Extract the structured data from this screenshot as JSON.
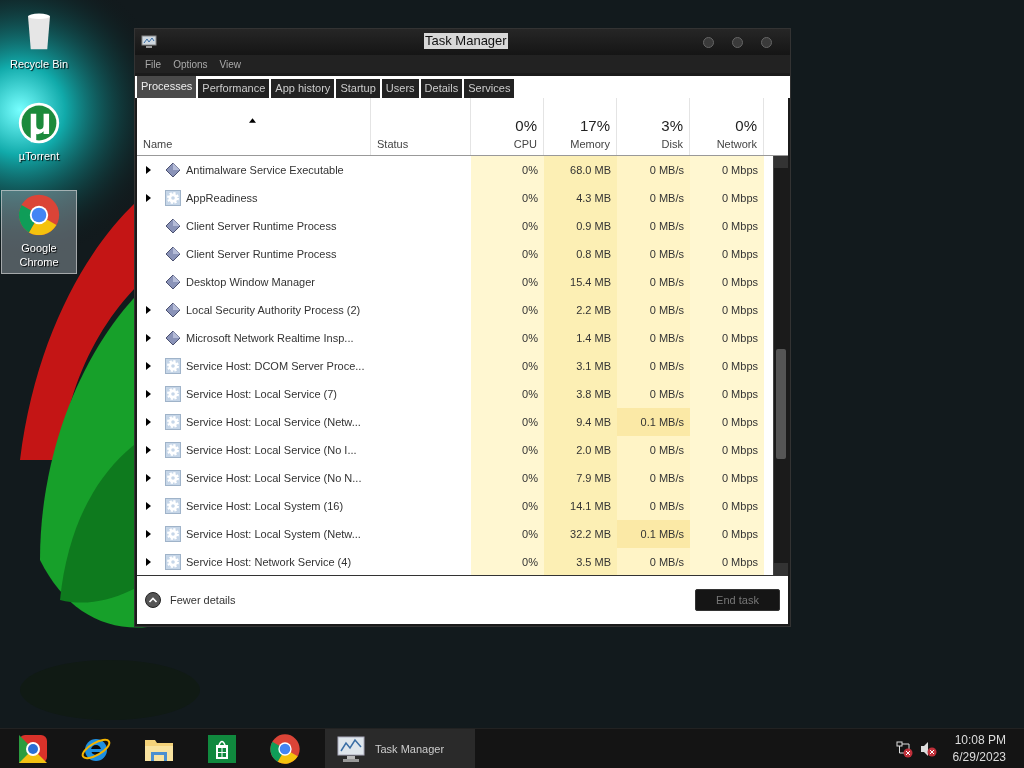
{
  "desktop": {
    "icons": [
      {
        "label": "Recycle Bin",
        "kind": "recycle",
        "selected": false
      },
      {
        "label": "µTorrent",
        "kind": "utorrent",
        "selected": false
      },
      {
        "label": "Google Chrome",
        "kind": "chrome",
        "selected": true
      }
    ]
  },
  "window": {
    "title": "Task Manager",
    "menu": [
      "File",
      "Options",
      "View"
    ],
    "tabs": [
      {
        "label": "Processes",
        "selected": true
      },
      {
        "label": "Performance",
        "selected": false
      },
      {
        "label": "App history",
        "selected": false
      },
      {
        "label": "Startup",
        "selected": false
      },
      {
        "label": "Users",
        "selected": false
      },
      {
        "label": "Details",
        "selected": false
      },
      {
        "label": "Services",
        "selected": false
      }
    ],
    "columns": [
      {
        "label": "Name",
        "sorted": true
      },
      {
        "label": "Status",
        "sorted": false
      },
      {
        "percent": "0%",
        "label": "CPU",
        "sorted": false
      },
      {
        "percent": "17%",
        "label": "Memory",
        "sorted": false
      },
      {
        "percent": "3%",
        "label": "Disk",
        "sorted": false
      },
      {
        "percent": "0%",
        "label": "Network",
        "sorted": false
      }
    ],
    "rows": [
      {
        "name": "Antimalware Service Executable",
        "kind": "diamond",
        "expandable": true,
        "cpu": "0%",
        "memory": "68.0 MB",
        "disk": "0 MB/s",
        "disk_active": false,
        "network": "0 Mbps"
      },
      {
        "name": "AppReadiness",
        "kind": "gear",
        "expandable": true,
        "cpu": "0%",
        "memory": "4.3 MB",
        "disk": "0 MB/s",
        "disk_active": false,
        "network": "0 Mbps"
      },
      {
        "name": "Client Server Runtime Process",
        "kind": "diamond",
        "expandable": false,
        "cpu": "0%",
        "memory": "0.9 MB",
        "disk": "0 MB/s",
        "disk_active": false,
        "network": "0 Mbps"
      },
      {
        "name": "Client Server Runtime Process",
        "kind": "diamond",
        "expandable": false,
        "cpu": "0%",
        "memory": "0.8 MB",
        "disk": "0 MB/s",
        "disk_active": false,
        "network": "0 Mbps"
      },
      {
        "name": "Desktop Window Manager",
        "kind": "diamond",
        "expandable": false,
        "cpu": "0%",
        "memory": "15.4 MB",
        "disk": "0 MB/s",
        "disk_active": false,
        "network": "0 Mbps"
      },
      {
        "name": "Local Security Authority Process (2)",
        "kind": "diamond",
        "expandable": true,
        "cpu": "0%",
        "memory": "2.2 MB",
        "disk": "0 MB/s",
        "disk_active": false,
        "network": "0 Mbps"
      },
      {
        "name": "Microsoft Network Realtime Insp...",
        "kind": "diamond",
        "expandable": true,
        "cpu": "0%",
        "memory": "1.4 MB",
        "disk": "0 MB/s",
        "disk_active": false,
        "network": "0 Mbps"
      },
      {
        "name": "Service Host: DCOM Server Proce...",
        "kind": "gear",
        "expandable": true,
        "cpu": "0%",
        "memory": "3.1 MB",
        "disk": "0 MB/s",
        "disk_active": false,
        "network": "0 Mbps"
      },
      {
        "name": "Service Host: Local Service (7)",
        "kind": "gear",
        "expandable": true,
        "cpu": "0%",
        "memory": "3.8 MB",
        "disk": "0 MB/s",
        "disk_active": false,
        "network": "0 Mbps"
      },
      {
        "name": "Service Host: Local Service (Netw...",
        "kind": "gear",
        "expandable": true,
        "cpu": "0%",
        "memory": "9.4 MB",
        "disk": "0.1 MB/s",
        "disk_active": true,
        "network": "0 Mbps"
      },
      {
        "name": "Service Host: Local Service (No I...",
        "kind": "gear",
        "expandable": true,
        "cpu": "0%",
        "memory": "2.0 MB",
        "disk": "0 MB/s",
        "disk_active": false,
        "network": "0 Mbps"
      },
      {
        "name": "Service Host: Local Service (No N...",
        "kind": "gear",
        "expandable": true,
        "cpu": "0%",
        "memory": "7.9 MB",
        "disk": "0 MB/s",
        "disk_active": false,
        "network": "0 Mbps"
      },
      {
        "name": "Service Host: Local System (16)",
        "kind": "gear",
        "expandable": true,
        "cpu": "0%",
        "memory": "14.1 MB",
        "disk": "0 MB/s",
        "disk_active": false,
        "network": "0 Mbps"
      },
      {
        "name": "Service Host: Local System (Netw...",
        "kind": "gear",
        "expandable": true,
        "cpu": "0%",
        "memory": "32.2 MB",
        "disk": "0.1 MB/s",
        "disk_active": true,
        "network": "0 Mbps"
      },
      {
        "name": "Service Host: Network Service (4)",
        "kind": "gear",
        "expandable": true,
        "cpu": "0%",
        "memory": "3.5 MB",
        "disk": "0 MB/s",
        "disk_active": false,
        "network": "0 Mbps"
      }
    ],
    "footer": {
      "toggle": "Fewer details",
      "button": "End task",
      "disabled": true
    }
  },
  "taskbar": {
    "pinned": [
      {
        "kind": "chrome-canary"
      },
      {
        "kind": "ie"
      },
      {
        "kind": "explorer"
      },
      {
        "kind": "store"
      },
      {
        "kind": "chrome"
      }
    ],
    "open_task": {
      "label": "Task Manager"
    },
    "tray": [
      {
        "kind": "network"
      },
      {
        "kind": "volume"
      }
    ],
    "clock": {
      "time": "10:08 PM",
      "date": "6/29/2023"
    }
  }
}
